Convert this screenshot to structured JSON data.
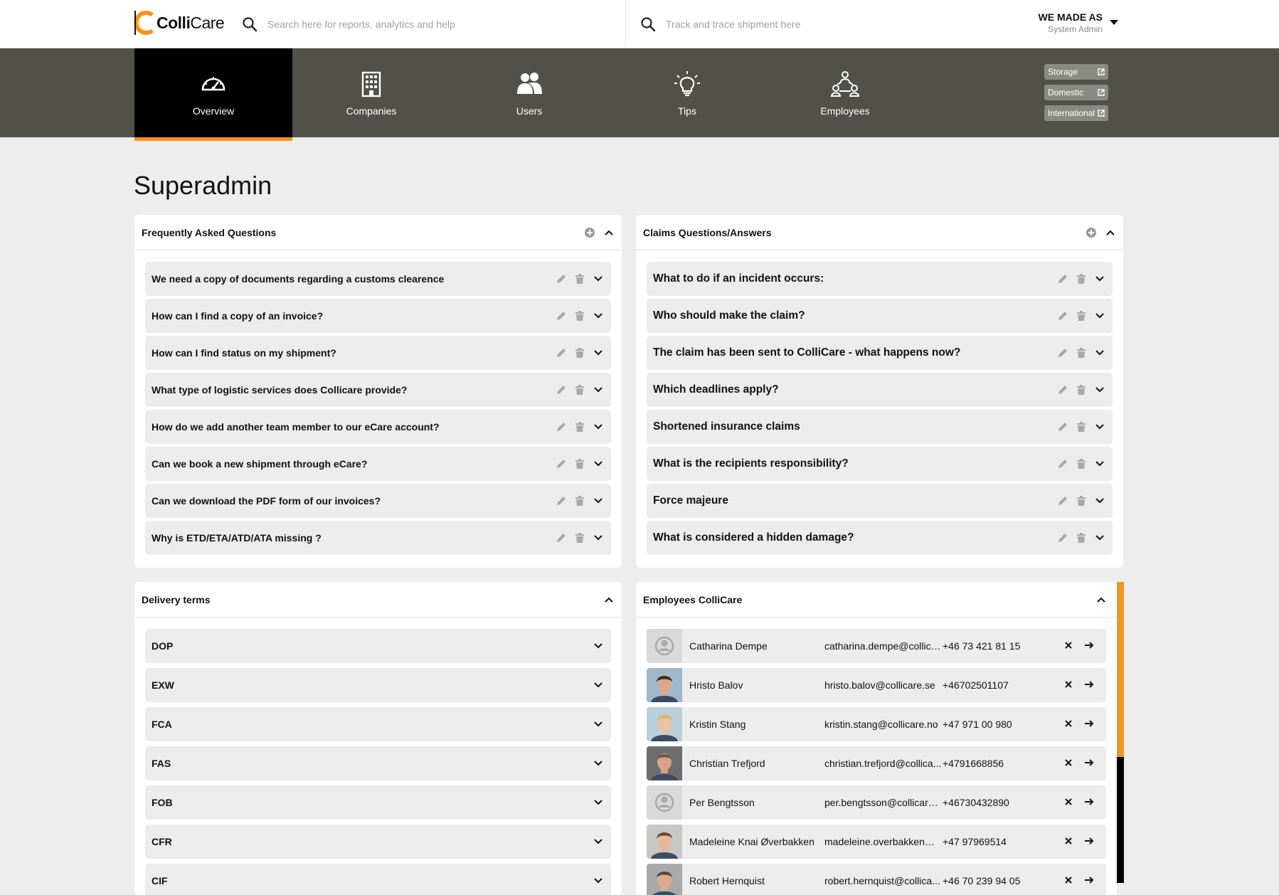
{
  "brand": {
    "name_bold": "Colli",
    "name_light": "Care",
    "accent": "#f7941d"
  },
  "search": {
    "reports_placeholder": "Search here for reports, analytics and help",
    "track_placeholder": "Track and trace shipment here"
  },
  "account": {
    "name": "WE MADE AS",
    "role": "System Admin"
  },
  "nav": {
    "items": [
      {
        "label": "Overview",
        "icon": "speedometer-icon",
        "active": true
      },
      {
        "label": "Companies",
        "icon": "building-icon"
      },
      {
        "label": "Users",
        "icon": "users-icon"
      },
      {
        "label": "Tips",
        "icon": "lightbulb-icon"
      },
      {
        "label": "Employees",
        "icon": "employees-network-icon"
      }
    ],
    "external_links": [
      "Storage",
      "Domestic",
      "International"
    ]
  },
  "page_title": "Superadmin",
  "faq": {
    "title": "Frequently Asked Questions",
    "items": [
      "We need a copy of documents regarding a customs clearence",
      "How can I find a copy of an invoice?",
      "How can I find status on my shipment?",
      "What type of logistic services does Collicare provide?",
      "How do we add another team member to our eCare account?",
      "Can we book a new shipment through eCare?",
      "Can we download the PDF form of our invoices?",
      "Why is ETD/ETA/ATD/ATA missing ?"
    ]
  },
  "claims": {
    "title": "Claims Questions/Answers",
    "items": [
      "What to do if an incident occurs:",
      "Who should make the claim?",
      "The claim has been sent to ColliCare - what happens now?",
      "Which deadlines apply?",
      "Shortened insurance claims",
      "What is the recipients responsibility?",
      "Force majeure",
      "What is considered a hidden damage?"
    ]
  },
  "delivery": {
    "title": "Delivery terms",
    "items": [
      "DOP",
      "EXW",
      "FCA",
      "FAS",
      "FOB",
      "CFR",
      "CIF"
    ]
  },
  "employees": {
    "title": "Employees ColliCare",
    "items": [
      {
        "name": "Catharina Dempe",
        "email": "catharina.dempe@collicare.se",
        "email_display": "catharina.dempe@collica...",
        "phone": "+46 73 421 81 15",
        "avatar": "placeholder"
      },
      {
        "name": "Hristo Balov",
        "email": "hristo.balov@collicare.se",
        "email_display": "hristo.balov@collicare.se",
        "phone": "+46702501107",
        "avatar": "photo",
        "skin": "#d8a88a",
        "hair": "#3a2a20",
        "bg": "#9fb7c9"
      },
      {
        "name": "Kristin Stang",
        "email": "kristin.stang@collicare.no",
        "email_display": "kristin.stang@collicare.no",
        "phone": "+47 971 00 980",
        "avatar": "photo",
        "skin": "#eac2a4",
        "hair": "#d8b870",
        "bg": "#b9cfd9"
      },
      {
        "name": "Christian Trefjord",
        "email": "christian.trefjord@collicare.no",
        "email_display": "christian.trefjord@collica...",
        "phone": "+4791668856",
        "avatar": "photo",
        "skin": "#d9a186",
        "hair": "#6b5a4a",
        "bg": "#6d6e6e"
      },
      {
        "name": "Per Bengtsson",
        "email": "per.bengtsson@collicare.se",
        "email_display": "per.bengtsson@collicare....",
        "phone": "+46730432890",
        "avatar": "placeholder"
      },
      {
        "name": "Madeleine Knai Øverbakken",
        "email": "madeleine.overbakken@collicare.no",
        "email_display": "madeleine.overbakken@...",
        "phone": "+47 97969514",
        "avatar": "photo",
        "skin": "#e5b79c",
        "hair": "#6b4a33",
        "bg": "#c8c7c3"
      },
      {
        "name": "Robert Hernquist",
        "email": "robert.hernquist@collicare.se",
        "email_display": "robert.hernquist@collica...",
        "phone": "+46 70 239 94 05",
        "avatar": "photo",
        "skin": "#dcaa90",
        "hair": "#55463a",
        "bg": "#a9a9a9"
      }
    ]
  }
}
